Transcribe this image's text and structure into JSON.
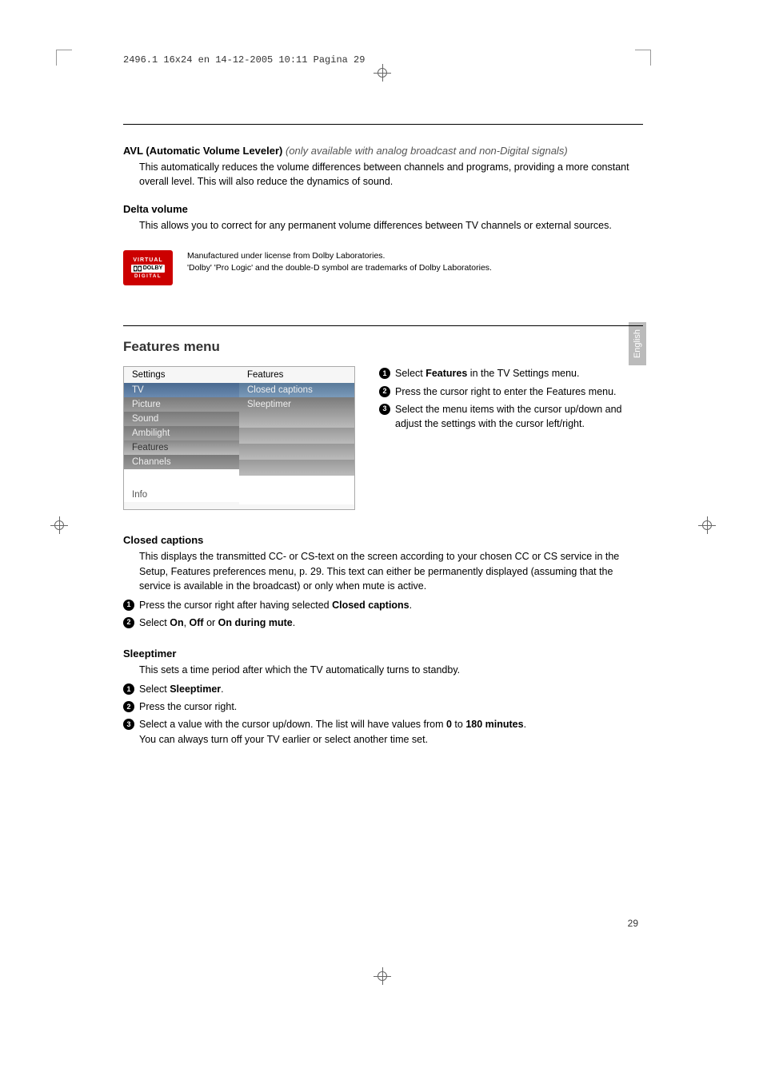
{
  "print_header": "2496.1 16x24 en  14-12-2005  10:11  Pagina 29",
  "avl": {
    "title": "AVL (Automatic Volume Leveler)",
    "note": "(only available with analog broadcast and non-Digital signals)",
    "body": "This automatically reduces the volume differences between channels and programs, providing a more constant overall level. This will also reduce the dynamics of sound."
  },
  "delta": {
    "title": "Delta volume",
    "body": "This allows you to correct for any permanent volume differences between TV channels or external sources."
  },
  "dolby": {
    "badge_top": "VIRTUAL",
    "badge_mid": "DOLBY",
    "badge_bot": "DIGITAL",
    "line1": "Manufactured under license from Dolby Laboratories.",
    "line2": "'Dolby' 'Pro Logic' and the double-D symbol are trademarks of Dolby Laboratories."
  },
  "features_heading": "Features menu",
  "menu": {
    "left_header": "Settings",
    "right_header": "Features",
    "left_items": [
      "TV",
      "Picture",
      "Sound",
      "Ambilight",
      "Features",
      "Channels"
    ],
    "right_items": [
      "Closed captions",
      "Sleeptimer"
    ],
    "info": "Info"
  },
  "feat_steps": {
    "s1a": "Select ",
    "s1b": "Features",
    "s1c": " in the TV Settings menu.",
    "s2": "Press the cursor right to enter the Features menu.",
    "s3": "Select the menu items with the cursor up/down and adjust the settings with the cursor left/right."
  },
  "cc": {
    "title": "Closed captions",
    "body": "This displays the transmitted CC- or CS-text on the screen according to your chosen CC or CS service in the Setup, Features preferences menu, p. 29. This text can either be permanently displayed (assuming that the service is available in the broadcast) or only when mute is active.",
    "s1a": "Press the cursor right after having selected ",
    "s1b": "Closed captions",
    "s1c": ".",
    "s2a": "Select ",
    "s2b": "On",
    "s2c": ", ",
    "s2d": "Off",
    "s2e": " or ",
    "s2f": "On during mute",
    "s2g": "."
  },
  "sleep": {
    "title": "Sleeptimer",
    "body": "This sets a time period after which the TV automatically turns to standby.",
    "s1a": "Select ",
    "s1b": "Sleeptimer",
    "s1c": ".",
    "s2": "Press the cursor right.",
    "s3a": "Select a value with the cursor up/down. The list will have values from ",
    "s3b": "0",
    "s3c": " to ",
    "s3d": "180 minutes",
    "s3e": ".",
    "s3f": "You can always turn off your TV earlier or select another time set."
  },
  "lang_tab": "English",
  "page_number": "29"
}
